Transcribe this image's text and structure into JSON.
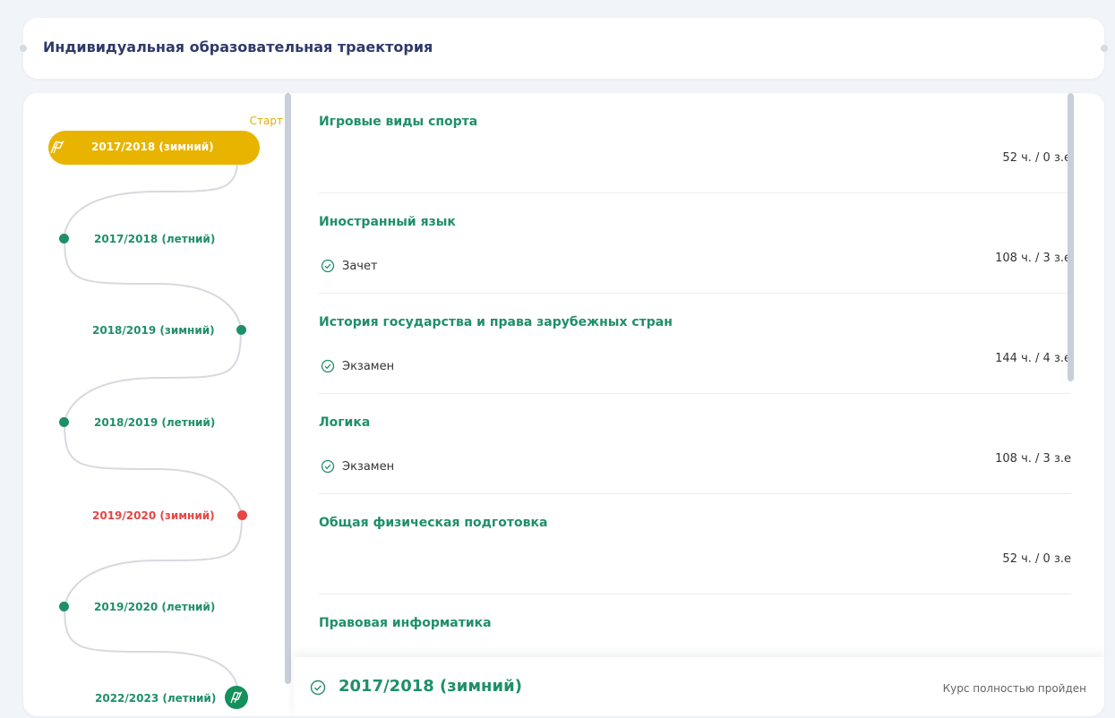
{
  "header": {
    "title": "Индивидуальная образовательная траектория"
  },
  "colors": {
    "accent_green": "#1f8f6a",
    "current_yellow": "#e8b400",
    "failed_red": "#e84545"
  },
  "timeline": {
    "start_label": "Старт",
    "current": {
      "label": "2017/2018 (зимний)",
      "icon": "flag-icon"
    },
    "semesters": [
      {
        "label": "2017/2018 (летний)",
        "status": "passed"
      },
      {
        "label": "2018/2019 (зимний)",
        "status": "passed"
      },
      {
        "label": "2018/2019 (летний)",
        "status": "passed"
      },
      {
        "label": "2019/2020 (зимний)",
        "status": "failed"
      },
      {
        "label": "2019/2020 (летний)",
        "status": "passed"
      },
      {
        "label": "2022/2023 (летний)",
        "status": "finish",
        "icon": "finish-flag-icon"
      }
    ]
  },
  "courses": [
    {
      "title": "Игровые виды спорта",
      "exam": "",
      "hours": "52 ч. / 0 з.е"
    },
    {
      "title": "Иностранный язык",
      "exam": "Зачет",
      "hours": "108 ч. / 3 з.е"
    },
    {
      "title": "История государства и права зарубежных стран",
      "exam": "Экзамен",
      "hours": "144 ч. / 4 з.е"
    },
    {
      "title": "Логика",
      "exam": "Экзамен",
      "hours": "108 ч. / 3 з.е"
    },
    {
      "title": "Общая физическая подготовка",
      "exam": "",
      "hours": "52 ч. / 0 з.е"
    },
    {
      "title": "Правовая информатика",
      "exam": "",
      "hours": ""
    }
  ],
  "footer": {
    "semester": "2017/2018 (зимний)",
    "status": "Курс полностью пройден"
  }
}
